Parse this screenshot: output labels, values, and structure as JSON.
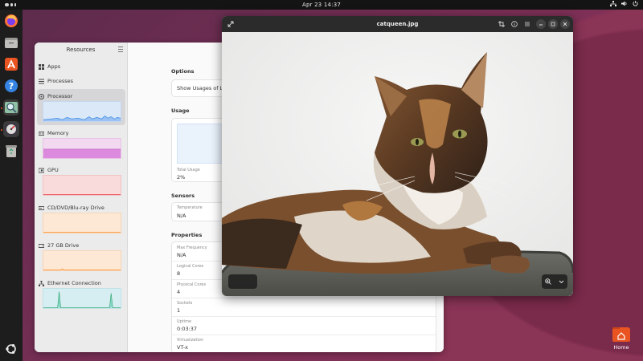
{
  "topbar": {
    "clock": "Apr 23  14:37"
  },
  "dock": {
    "items": [
      {
        "name": "firefox"
      },
      {
        "name": "files"
      },
      {
        "name": "app-center"
      },
      {
        "name": "help"
      },
      {
        "name": "image-viewer"
      },
      {
        "name": "system-monitor"
      },
      {
        "name": "trash"
      }
    ]
  },
  "monitor": {
    "sidebar": {
      "title": "Resources",
      "items": [
        {
          "label": "Apps"
        },
        {
          "label": "Processes"
        },
        {
          "label": "Processor"
        },
        {
          "label": "Memory"
        },
        {
          "label": "GPU"
        },
        {
          "label": "CD/DVD/Blu-ray Drive"
        },
        {
          "label": "27 GB Drive"
        },
        {
          "label": "Ethernet Connection"
        }
      ]
    },
    "main": {
      "options_title": "Options",
      "options_button": "Show Usages of Logi",
      "usage_title": "Usage",
      "total_usage_label": "Total Usage",
      "total_usage_value": "2%",
      "sensors_title": "Sensors",
      "temperature_label": "Temperature",
      "temperature_value": "N/A",
      "properties_title": "Properties",
      "properties": [
        {
          "label": "Max Frequency",
          "value": "N/A"
        },
        {
          "label": "Logical Cores",
          "value": "8"
        },
        {
          "label": "Physical Cores",
          "value": "4"
        },
        {
          "label": "Sockets",
          "value": "1"
        },
        {
          "label": "Uptime",
          "value": "0:03:37"
        },
        {
          "label": "Virtualization",
          "value": "VT-x"
        }
      ]
    }
  },
  "viewer": {
    "title": "catqueen.jpg"
  },
  "desktop": {
    "home_label": "Home"
  },
  "colors": {
    "accent": "#e95420",
    "processor_graph": "#99c1f1",
    "memory_graph": "#dc8add",
    "gpu_graph": "#f66151",
    "disk_graph": "#ffbe6f",
    "network_graph": "#5bc8af"
  }
}
